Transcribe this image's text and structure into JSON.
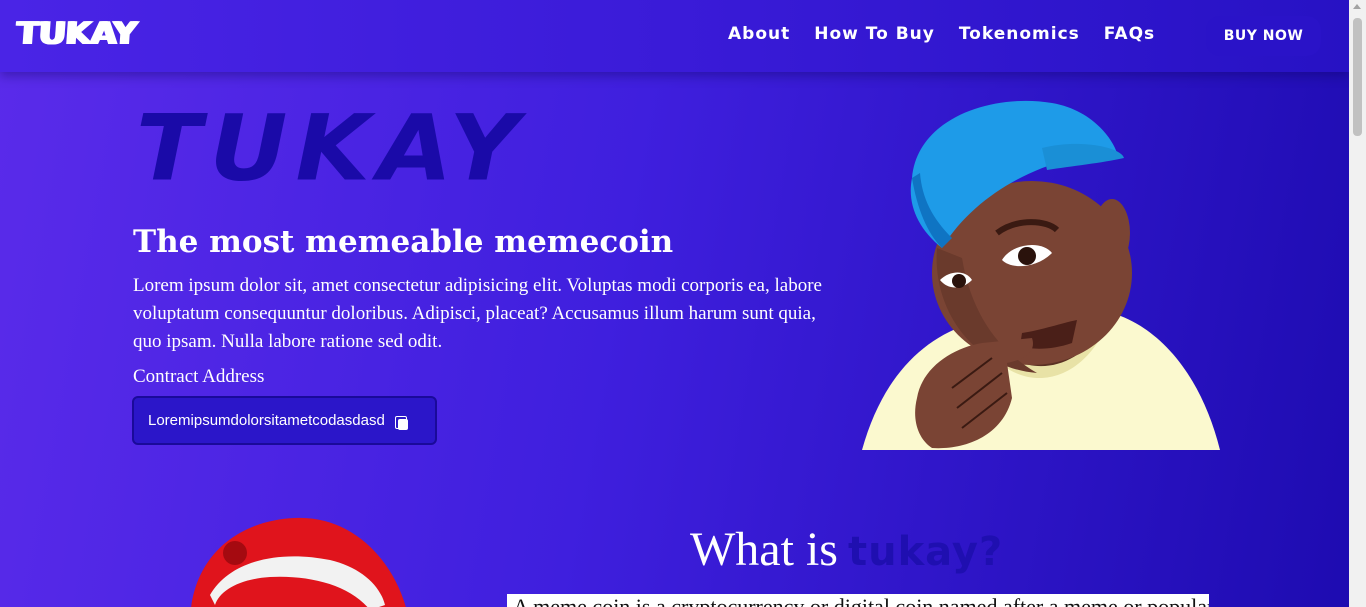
{
  "header": {
    "logo": "TUKAY",
    "nav": [
      {
        "label": "About"
      },
      {
        "label": "How To Buy"
      },
      {
        "label": "Tokenomics"
      },
      {
        "label": "FAQs"
      }
    ],
    "buy_button": "BUY NOW"
  },
  "hero": {
    "background_title": "TUKAY",
    "title": "The most memeable memecoin",
    "description": "Lorem ipsum dolor sit, amet consectetur adipisicing elit. Voluptas modi corporis ea, labore voluptatum consequuntur doloribus. Adipisci, placeat? Accusamus illum harum sunt quia, quo ipsam. Nulla labore ratione sed odit.",
    "contract_label": "Contract Address",
    "contract_value": "Loremipsumdolorsitametcodasdasd"
  },
  "about": {
    "title_prefix": "What is",
    "title_accent": "tukay?",
    "card_text": "A meme coin is a cryptocurrency or digital coin named after a meme or popular internet joke"
  },
  "colors": {
    "bg_start": "#5a2bea",
    "bg_end": "#1d0bb0",
    "accent_dark": "#1a0aa8",
    "button": "#2a13c8",
    "cap_blue": "#1e9be8",
    "santa_red": "#e0141c"
  }
}
